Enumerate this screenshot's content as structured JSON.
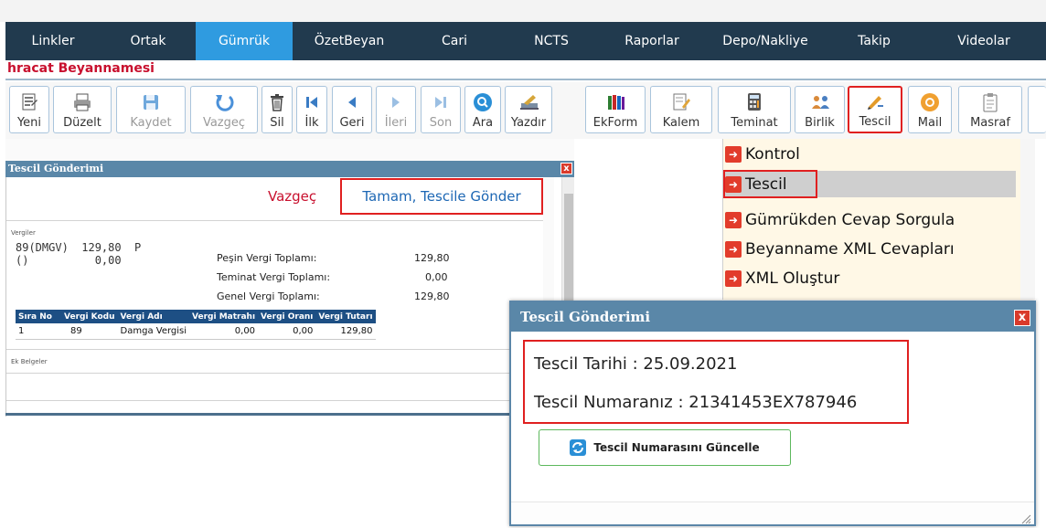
{
  "nav": {
    "items": [
      {
        "label": "Linkler",
        "width": 104
      },
      {
        "label": "Ortak",
        "width": 104
      },
      {
        "label": "Gümrük",
        "width": 106,
        "active": true
      },
      {
        "label": "ÖzetBeyan",
        "width": 124
      },
      {
        "label": "Cari",
        "width": 106
      },
      {
        "label": "NCTS",
        "width": 106
      },
      {
        "label": "Raporlar",
        "width": 114
      },
      {
        "label": "Depo/Nakliye",
        "width": 134
      },
      {
        "label": "Takip",
        "width": 104
      },
      {
        "label": "Videolar",
        "width": 136
      }
    ]
  },
  "page": {
    "title": "hracat Beyannamesi"
  },
  "toolbar": {
    "yeni": "Yeni",
    "duzelt": "Düzelt",
    "kaydet": "Kaydet",
    "vazgec": "Vazgeç",
    "sil": "Sil",
    "ilk": "İlk",
    "geri": "Geri",
    "ileri": "İleri",
    "son": "Son",
    "ara": "Ara",
    "yazdir": "Yazdır",
    "ekform": "EkForm",
    "kalem": "Kalem",
    "teminat": "Teminat",
    "birlik": "Birlik",
    "tescil": "Tescil",
    "mail": "Mail",
    "masraf": "Masraf"
  },
  "left_window": {
    "title": "Tescil Gönderimi",
    "close": "x",
    "cancel_label": "Vazgeç",
    "ok_label": "Tamam, Tescile Gönder",
    "section_taxes": "Vergiler",
    "tax_code_line": "89(DMGV)  129,80  P",
    "tax_code_line2": "()          0,00",
    "totals": [
      {
        "label": "Peşin Vergi Toplamı:",
        "value": "129,80"
      },
      {
        "label": "Teminat Vergi Toplamı:",
        "value": "0,00"
      },
      {
        "label": "Genel Vergi Toplamı:",
        "value": "129,80"
      }
    ],
    "table": {
      "headers": [
        "Sıra No",
        "Vergi Kodu",
        "Vergi Adı",
        "Vergi Matrahı",
        "Vergi Oranı",
        "Vergi Tutarı"
      ],
      "rows": [
        [
          "1",
          "89",
          "Damga Vergisi",
          "0,00",
          "0,00",
          "129,80"
        ]
      ]
    },
    "section_attachments": "Ek Belgeler"
  },
  "dropdown": {
    "items": [
      "Kontrol",
      "Tescil",
      "Gümrükden Cevap Sorgula",
      "Beyanname XML Cevapları",
      "XML Oluştur"
    ],
    "selected": "Tescil",
    "arrow": "➜"
  },
  "dialog": {
    "title": "Tescil Gönderimi",
    "close": "x",
    "date_line": "Tescil Tarihi : 25.09.2021",
    "number_line": "Tescil Numaranız : 21341453EX787946",
    "update_button": "Tescil Numarasını Güncelle"
  },
  "colors": {
    "nav_bg": "#213a4e",
    "nav_active": "#2f9be0",
    "title_bar": "#5a87a8",
    "highlight_red": "#e02020",
    "table_header": "#1d4f84"
  }
}
